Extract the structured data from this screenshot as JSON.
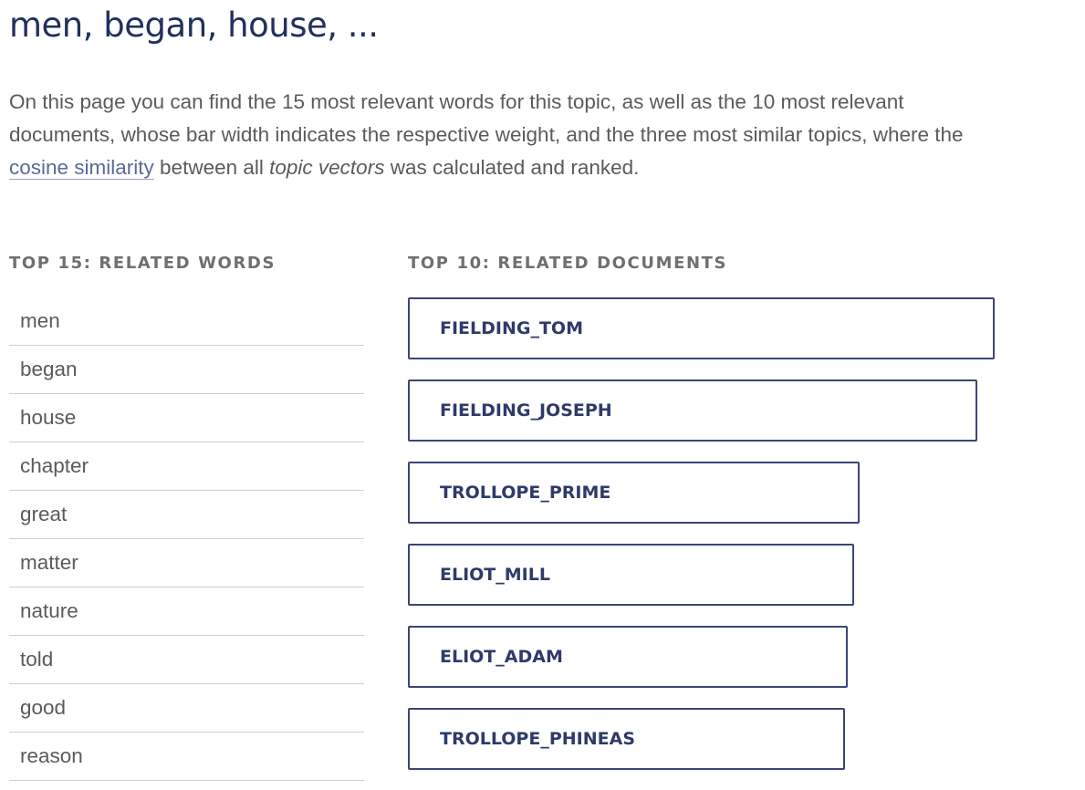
{
  "title": "men, began, house, ...",
  "intro": {
    "part1": "On this page you can find the 15 most relevant words for this topic, as well as the 10 most relevant documents, whose bar width indicates the respective weight, and the three most similar topics, where the ",
    "link": "cosine similarity",
    "part2": " between all ",
    "emphasis": "topic vectors",
    "part3": " was calculated and ranked."
  },
  "words_heading": "TOP 15: RELATED WORDS",
  "docs_heading": "TOP 10: RELATED DOCUMENTS",
  "words": [
    "men",
    "began",
    "house",
    "chapter",
    "great",
    "matter",
    "nature",
    "told",
    "good",
    "reason"
  ],
  "documents": [
    {
      "label": "FIELDING_TOM",
      "weight": 1.0
    },
    {
      "label": "FIELDING_JOSEPH",
      "weight": 0.97
    },
    {
      "label": "TROLLOPE_PRIME",
      "weight": 0.77
    },
    {
      "label": "ELIOT_MILL",
      "weight": 0.76
    },
    {
      "label": "ELIOT_ADAM",
      "weight": 0.75
    },
    {
      "label": "TROLLOPE_PHINEAS",
      "weight": 0.745
    }
  ],
  "colors": {
    "title": "#21305e",
    "link": "#5a6a9a",
    "bar_border": "#3c4577",
    "bar_text": "#2f3a6b"
  }
}
